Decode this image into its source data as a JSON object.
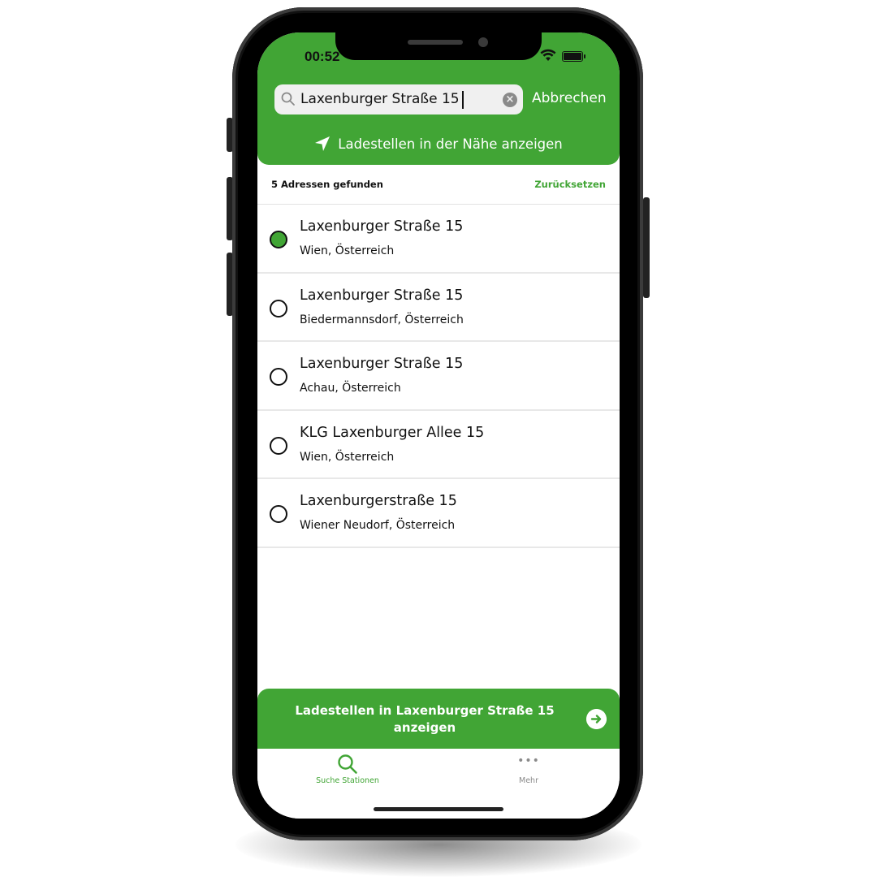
{
  "status_bar": {
    "time": "00:52"
  },
  "search": {
    "value": "Laxenburger Straße 15",
    "cancel_label": "Abbrechen",
    "nearby_label": "Ladestellen in der Nähe anzeigen"
  },
  "results": {
    "count_label": "5 Adressen gefunden",
    "reset_label": "Zurücksetzen",
    "selected_index": 0,
    "items": [
      {
        "title": "Laxenburger Straße 15",
        "subtitle": "Wien, Österreich"
      },
      {
        "title": "Laxenburger Straße 15",
        "subtitle": "Biedermannsdorf, Österreich"
      },
      {
        "title": "Laxenburger Straße 15",
        "subtitle": "Achau, Österreich"
      },
      {
        "title": "KLG Laxenburger Allee 15",
        "subtitle": "Wien, Österreich"
      },
      {
        "title": "Laxenburgerstraße 15",
        "subtitle": "Wiener Neudorf, Österreich"
      }
    ]
  },
  "cta": {
    "label": "Ladestellen in Laxenburger Straße 15 anzeigen",
    "icon": "arrow-right-circle-icon"
  },
  "tabbar": {
    "tabs": [
      {
        "label": "Suche Stationen",
        "icon": "search-icon",
        "active": true
      },
      {
        "label": "Mehr",
        "icon": "more-dots-icon",
        "active": false
      }
    ]
  },
  "colors": {
    "accent": "#41a535",
    "text": "#111111",
    "inactive": "#8a8a8a"
  }
}
